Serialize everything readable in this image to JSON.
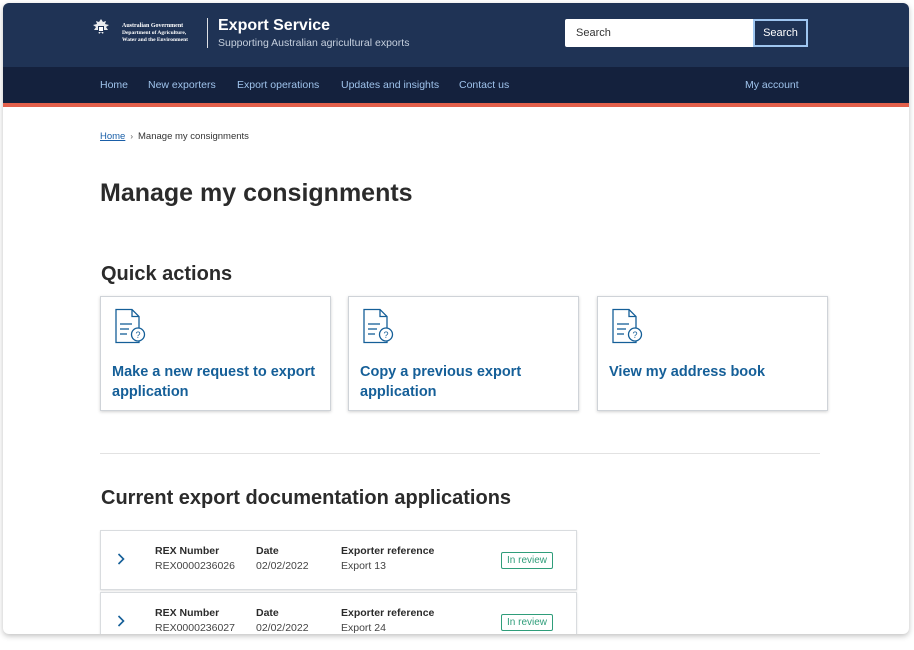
{
  "header": {
    "gov_lines": [
      "Australian Government",
      "Department of Agriculture,",
      "Water and the Environment"
    ],
    "service_title": "Export Service",
    "service_subtitle": "Supporting Australian agricultural exports",
    "search": {
      "placeholder": "Search",
      "button_label": "Search"
    }
  },
  "nav": {
    "items": [
      "Home",
      "New exporters",
      "Export operations",
      "Updates and insights",
      "Contact us"
    ],
    "account": "My account"
  },
  "colors": {
    "header_bg": "#1f3355",
    "nav_bg": "#14213d",
    "accent": "#e3604b",
    "link": "#155f98",
    "status_green": "#2f9d7a"
  },
  "breadcrumb": {
    "home": "Home",
    "current": "Manage my consignments"
  },
  "page_title": "Manage my consignments",
  "quick_actions": {
    "heading": "Quick actions",
    "cards": [
      {
        "icon": "document-question-icon",
        "label": "Make a new request to export application"
      },
      {
        "icon": "document-question-icon",
        "label": "Copy a previous export application"
      },
      {
        "icon": "document-question-icon",
        "label": "View my address book"
      }
    ]
  },
  "applications": {
    "heading": "Current export documentation applications",
    "column_labels": {
      "rex": "REX Number",
      "date": "Date",
      "ref": "Exporter reference"
    },
    "rows": [
      {
        "rex": "REX0000236026",
        "date": "02/02/2022",
        "ref": "Export 13",
        "status": "In review"
      },
      {
        "rex": "REX0000236027",
        "date": "02/02/2022",
        "ref": "Export 24",
        "status": "In review"
      }
    ]
  }
}
